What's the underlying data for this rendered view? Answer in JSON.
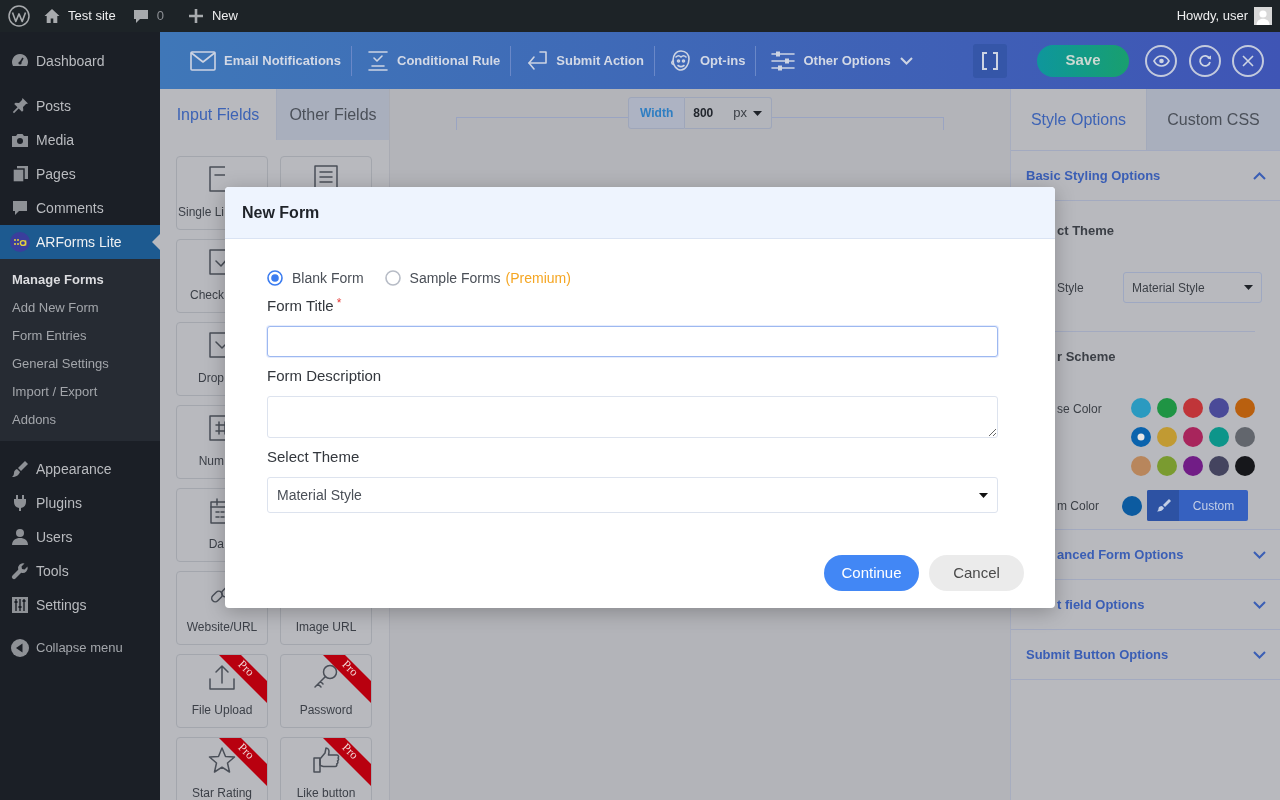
{
  "admin_bar": {
    "site": "Test site",
    "comments": "0",
    "new": "New",
    "greeting": "Howdy, user"
  },
  "sidebar": {
    "groups": [
      {
        "items": [
          {
            "label": "Dashboard",
            "selected": false
          }
        ]
      },
      {
        "items": [
          {
            "label": "Posts",
            "selected": false
          },
          {
            "label": "Media",
            "selected": false
          },
          {
            "label": "Pages",
            "selected": false
          },
          {
            "label": "Comments",
            "selected": false
          },
          {
            "label": "ARForms Lite",
            "selected": true,
            "children": [
              {
                "label": "Manage Forms",
                "selected": true
              },
              {
                "label": "Add New Form",
                "selected": false
              },
              {
                "label": "Form Entries",
                "selected": false
              },
              {
                "label": "General Settings",
                "selected": false
              },
              {
                "label": "Import / Export",
                "selected": false
              },
              {
                "label": "Addons",
                "selected": false
              }
            ]
          }
        ]
      },
      {
        "items": [
          {
            "label": "Appearance",
            "selected": false
          },
          {
            "label": "Plugins",
            "selected": false
          },
          {
            "label": "Users",
            "selected": false
          },
          {
            "label": "Tools",
            "selected": false
          },
          {
            "label": "Settings",
            "selected": false
          }
        ]
      }
    ],
    "collapse": "Collapse menu"
  },
  "toolbar": {
    "items": [
      {
        "label": "Email Notifications",
        "menu": false
      },
      {
        "label": "Conditional Rule",
        "menu": false
      },
      {
        "label": "Submit Action",
        "menu": false
      },
      {
        "label": "Opt-ins",
        "menu": false
      },
      {
        "label": "Other Options",
        "menu": true
      }
    ],
    "save": "Save"
  },
  "left_panel": {
    "tabs": [
      {
        "label": "Input Fields",
        "selected": true
      },
      {
        "label": "Other Fields",
        "selected": false
      }
    ],
    "left_column": [
      {
        "kind": "field",
        "label": "Single Li"
      },
      {
        "kind": "field",
        "label": "Check"
      },
      {
        "kind": "field",
        "label": "Drop"
      },
      {
        "kind": "field",
        "label": "Num"
      },
      {
        "kind": "field",
        "label": "Da"
      },
      {
        "kind": "field",
        "label": "Website/URL"
      },
      {
        "kind": "field",
        "label": "File Upload",
        "badge": "Pro"
      },
      {
        "kind": "field",
        "label": "Star Rating",
        "badge": "Pro"
      }
    ],
    "right_column": [
      {
        "kind": "field"
      },
      {
        "kind": "field",
        "label": "Image URL"
      },
      {
        "kind": "field",
        "label": "Password",
        "badge": "Pro"
      },
      {
        "kind": "field",
        "label": "Like button",
        "badge": "Pro"
      }
    ]
  },
  "canvas": {
    "width_control": {
      "label": "Width",
      "value": "800",
      "unit": "px"
    }
  },
  "right_panel": {
    "tabs": [
      {
        "label": "Style Options",
        "selected": true
      },
      {
        "label": "Custom CSS",
        "selected": false
      }
    ],
    "sections": [
      {
        "title": "Basic Styling Options",
        "expanded": true,
        "theme_heading": "ct Theme",
        "style_label": "Style",
        "style_value": "Material Style",
        "color_heading": "r Scheme",
        "base_color_label": "se Color",
        "swatches": [
          {
            "color": "#2b9ac0",
            "selected": false
          },
          {
            "color": "#1f9444",
            "selected": false
          },
          {
            "color": "#c03539",
            "selected": false
          },
          {
            "color": "#4a4a98",
            "selected": false
          },
          {
            "color": "#b9600f",
            "selected": false
          },
          {
            "color": "#0a63ad",
            "selected": true
          },
          {
            "color": "#c19a33",
            "selected": false
          },
          {
            "color": "#a8255c",
            "selected": false
          },
          {
            "color": "#0d958a",
            "selected": false
          },
          {
            "color": "#62666d",
            "selected": false
          },
          {
            "color": "#b8865c",
            "selected": false
          },
          {
            "color": "#7a9b30",
            "selected": false
          },
          {
            "color": "#711d86",
            "selected": false
          },
          {
            "color": "#44445f",
            "selected": false
          },
          {
            "color": "#16171b",
            "selected": false
          }
        ],
        "custom_color_label": "m Color",
        "custom_button": "Custom"
      },
      {
        "title": "anced Form Options",
        "expanded": false
      },
      {
        "title": "t field Options",
        "expanded": false
      },
      {
        "title": "Submit Button Options",
        "expanded": false
      }
    ]
  },
  "modal": {
    "title": "New Form",
    "options": [
      {
        "label": "Blank Form",
        "selected": true
      },
      {
        "label": "Sample Forms",
        "note": "(Premium)",
        "selected": false
      }
    ],
    "fields": [
      {
        "kind": "input",
        "label": "Form Title",
        "required_mark": "*",
        "focused": true
      },
      {
        "kind": "textarea",
        "label": "Form Description",
        "focused": false
      },
      {
        "kind": "select",
        "label": "Select Theme",
        "value": "Material Style",
        "focused": false
      }
    ],
    "buttons": [
      {
        "label": "Continue",
        "kind": "primary"
      },
      {
        "label": "Cancel",
        "kind": "secondary"
      }
    ]
  }
}
